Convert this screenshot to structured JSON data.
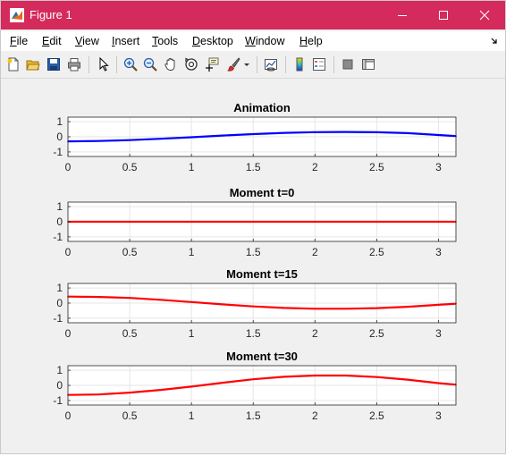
{
  "window": {
    "title": "Figure 1",
    "accent_color": "#d52a5c",
    "controls": [
      "minimize-icon",
      "maximize-icon",
      "close-icon"
    ]
  },
  "menu": {
    "items": [
      {
        "label": "File",
        "key": "F",
        "rest": "ile"
      },
      {
        "label": "Edit",
        "key": "E",
        "rest": "dit"
      },
      {
        "label": "View",
        "key": "V",
        "rest": "iew"
      },
      {
        "label": "Insert",
        "key": "I",
        "rest": "nsert"
      },
      {
        "label": "Tools",
        "key": "T",
        "rest": "ools"
      },
      {
        "label": "Desktop",
        "key": "D",
        "rest": "esktop"
      },
      {
        "label": "Window",
        "key": "W",
        "rest": "indow"
      },
      {
        "label": "Help",
        "key": "H",
        "rest": "elp"
      }
    ]
  },
  "toolbar": {
    "icons": [
      "new-figure-icon",
      "open-icon",
      "save-icon",
      "print-icon",
      "edit-plot-arrow-icon",
      "zoom-in-icon",
      "zoom-out-icon",
      "pan-icon",
      "rotate-3d-icon",
      "data-cursor-icon",
      "brush-icon",
      "brush-dropdown-icon",
      "link-plot-icon",
      "colorbar-icon",
      "legend-icon",
      "hide-plot-tools-icon",
      "show-plot-tools-icon"
    ]
  },
  "chart_data": [
    {
      "type": "line",
      "title": "Animation",
      "color": "#0000ff",
      "xlim": [
        0,
        3.14159
      ],
      "ylim": [
        -1.3,
        1.3
      ],
      "xticks": [
        "0",
        "0.5",
        "1",
        "1.5",
        "2",
        "2.5",
        "3"
      ],
      "yticks": [
        "1",
        "0",
        "-1"
      ],
      "x": [
        0,
        0.25,
        0.5,
        0.75,
        1.0,
        1.25,
        1.5,
        1.75,
        2.0,
        2.25,
        2.5,
        2.75,
        3.0,
        3.1416
      ],
      "y": [
        -0.3,
        -0.28,
        -0.22,
        -0.13,
        -0.03,
        0.08,
        0.18,
        0.26,
        0.31,
        0.32,
        0.3,
        0.24,
        0.12,
        0.05
      ]
    },
    {
      "type": "line",
      "title": "Moment t=0",
      "color": "#ff0000",
      "xlim": [
        0,
        3.14159
      ],
      "ylim": [
        -1.3,
        1.3
      ],
      "xticks": [
        "0",
        "0.5",
        "1",
        "1.5",
        "2",
        "2.5",
        "3"
      ],
      "yticks": [
        "1",
        "0",
        "-1"
      ],
      "x": [
        0,
        3.1416
      ],
      "y": [
        0,
        0
      ]
    },
    {
      "type": "line",
      "title": "Moment t=15",
      "color": "#ff0000",
      "xlim": [
        0,
        3.14159
      ],
      "ylim": [
        -1.3,
        1.3
      ],
      "xticks": [
        "0",
        "0.5",
        "1",
        "1.5",
        "2",
        "2.5",
        "3"
      ],
      "yticks": [
        "1",
        "0",
        "-1"
      ],
      "x": [
        0,
        0.25,
        0.5,
        0.75,
        1.0,
        1.25,
        1.5,
        1.75,
        2.0,
        2.25,
        2.5,
        2.75,
        3.0,
        3.1416
      ],
      "y": [
        0.43,
        0.41,
        0.34,
        0.22,
        0.07,
        -0.08,
        -0.22,
        -0.32,
        -0.37,
        -0.37,
        -0.33,
        -0.24,
        -0.11,
        -0.04
      ]
    },
    {
      "type": "line",
      "title": "Moment t=30",
      "color": "#ff0000",
      "xlim": [
        0,
        3.14159
      ],
      "ylim": [
        -1.3,
        1.3
      ],
      "xticks": [
        "0",
        "0.5",
        "1",
        "1.5",
        "2",
        "2.5",
        "3"
      ],
      "yticks": [
        "1",
        "0",
        "-1"
      ],
      "x": [
        0,
        0.25,
        0.5,
        0.75,
        1.0,
        1.25,
        1.5,
        1.75,
        2.0,
        2.25,
        2.5,
        2.75,
        3.0,
        3.1416
      ],
      "y": [
        -0.63,
        -0.6,
        -0.48,
        -0.3,
        -0.08,
        0.17,
        0.4,
        0.57,
        0.65,
        0.65,
        0.55,
        0.38,
        0.15,
        0.05
      ]
    }
  ]
}
